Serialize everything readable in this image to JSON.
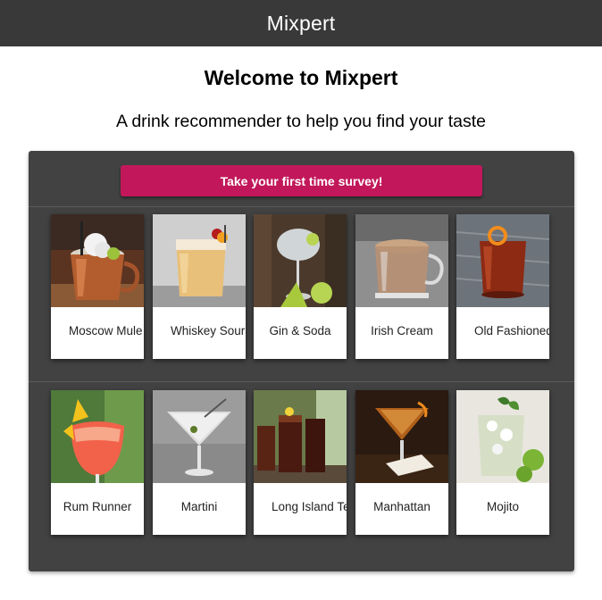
{
  "app": {
    "title": "Mixpert"
  },
  "welcome": {
    "title": "Welcome to Mixpert",
    "subtitle": "A drink recommender to help you find your taste"
  },
  "survey_button": {
    "label": "Take your first time survey!"
  },
  "drinks_row1": [
    {
      "name": "Moscow Mule",
      "icon": "copper-mug-cocktail-photo"
    },
    {
      "name": "Whiskey Sour",
      "icon": "whiskey-sour-glass-photo"
    },
    {
      "name": "Gin & Soda",
      "icon": "gin-soda-glass-photo"
    },
    {
      "name": "Irish Cream",
      "icon": "irish-cream-mug-photo"
    },
    {
      "name": "Old Fashioned",
      "icon": "old-fashioned-glass-photo"
    }
  ],
  "drinks_row2": [
    {
      "name": "Rum Runner",
      "icon": "rum-runner-glass-photo"
    },
    {
      "name": "Martini",
      "icon": "martini-glass-photo"
    },
    {
      "name": "Long Island Tea",
      "icon": "long-island-glasses-photo"
    },
    {
      "name": "Manhattan",
      "icon": "manhattan-glass-photo"
    },
    {
      "name": "Mojito",
      "icon": "mojito-glass-photo"
    }
  ],
  "colors": {
    "appbar": "#393939",
    "panel": "#424242",
    "accent": "#c2185b"
  }
}
